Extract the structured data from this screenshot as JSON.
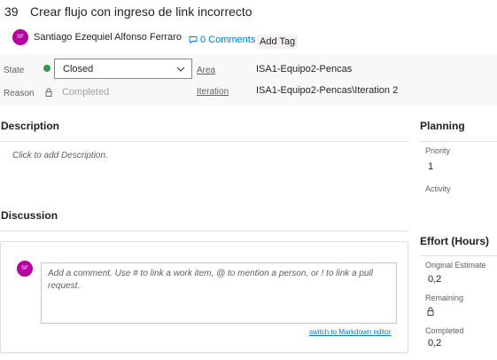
{
  "work_item": {
    "id": "39",
    "title": "Crear flujo con ingreso de link incorrecto"
  },
  "owner": {
    "initials": "SF",
    "name": "Santiago Ezequiel Alfonso Ferraro"
  },
  "header_actions": {
    "comments_label": "0 Comments",
    "add_tag_label": "Add Tag"
  },
  "fields": {
    "state_label": "State",
    "state_value": "Closed",
    "reason_label": "Reason",
    "reason_value": "Completed",
    "area_label": "Area",
    "area_value": "ISA1-Equipo2-Pencas",
    "iteration_label": "Iteration",
    "iteration_value": "ISA1-Equipo2-Pencas\\Iteration 2"
  },
  "description": {
    "title": "Description",
    "placeholder": "Click to add Description."
  },
  "discussion": {
    "title": "Discussion",
    "avatar_initials": "SF",
    "comment_placeholder": "Add a comment. Use # to link a work item, @ to mention a person, or ! to link a pull request.",
    "markdown_link": "switch to Markdown editor"
  },
  "planning": {
    "title": "Planning",
    "priority_label": "Priority",
    "priority_value": "1",
    "activity_label": "Activity"
  },
  "effort": {
    "title": "Effort (Hours)",
    "original_estimate_label": "Original Estimate",
    "original_estimate_value": "0,2",
    "remaining_label": "Remaining",
    "completed_label": "Completed",
    "completed_value": "0,2"
  },
  "icons": {
    "state_dot": "status-dot-icon",
    "chevron": "chevron-down-icon",
    "lock": "lock-icon",
    "comment": "comment-icon"
  },
  "colors": {
    "accent": "#0078d4",
    "avatar": "#b4009e",
    "state_closed": "#339947"
  }
}
